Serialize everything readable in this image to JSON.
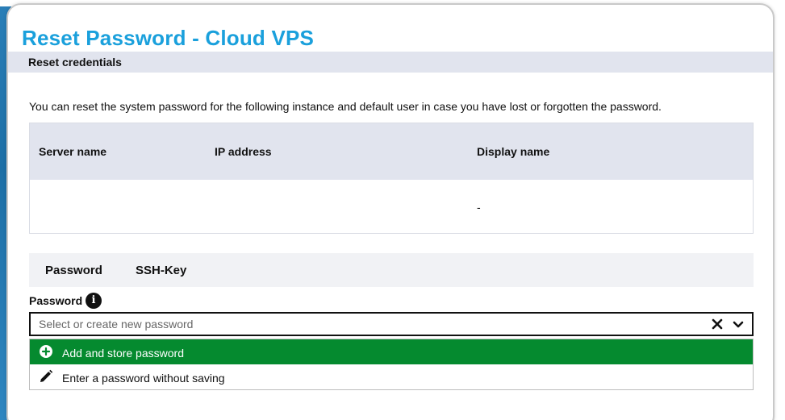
{
  "modal": {
    "title": "Reset Password - Cloud VPS",
    "section_heading": "Reset credentials",
    "intro_text": "You can reset the system password for the following instance and default user in case you have lost or forgotten the password."
  },
  "instance_table": {
    "headers": {
      "server_name": "Server name",
      "ip_address": "IP address",
      "display_name": "Display name"
    },
    "row": {
      "server_name": "",
      "ip_address": "",
      "display_name": "-"
    }
  },
  "tabs": [
    {
      "label": "Password"
    },
    {
      "label": "SSH-Key"
    }
  ],
  "password_field": {
    "label": "Password",
    "info_icon": "info-icon",
    "value": "",
    "placeholder": "Select or create new password",
    "clear_icon": "close-icon",
    "toggle_icon": "chevron-down-icon"
  },
  "dropdown_options": [
    {
      "label": "Add and store password",
      "icon": "plus-circle-icon",
      "highlighted": true
    },
    {
      "label": "Enter a password without saving",
      "icon": "pencil-icon",
      "highlighted": false
    }
  ],
  "colors": {
    "title": "#1aa0dc",
    "section_bar": "#e1e4ee",
    "highlight_option": "#058a2f",
    "backdrop": "#2a7fb8"
  }
}
